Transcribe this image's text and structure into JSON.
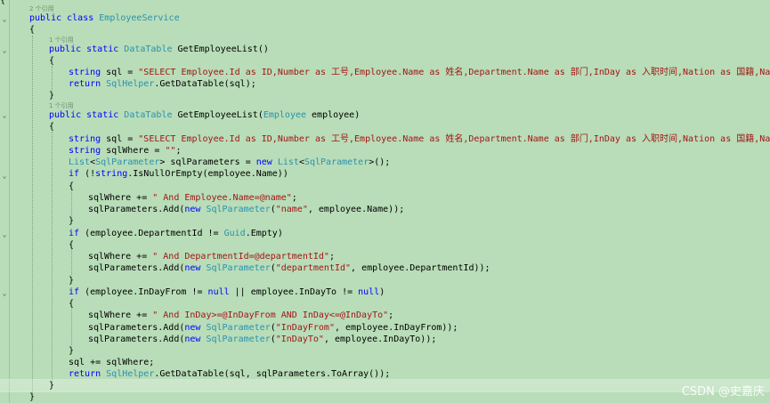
{
  "colors": {
    "background": "#b8ddb8",
    "keyword": "#0000ff",
    "type": "#2b91af",
    "string": "#a31515",
    "codelens": "#6f8f6f"
  },
  "codelens": {
    "class_refs": "2 个引用",
    "method1_refs": "1 个引用",
    "method2_refs": "1 个引用"
  },
  "watermark": "CSDN @史嘉庆",
  "lines": [
    {
      "id": "l0",
      "tokens": [
        {
          "t": "p",
          "v": "{"
        }
      ]
    },
    {
      "id": "l1",
      "tokens": [
        {
          "t": "kw",
          "v": "public class "
        },
        {
          "t": "ty",
          "v": "EmployeeService"
        }
      ]
    },
    {
      "id": "l2",
      "tokens": [
        {
          "t": "p",
          "v": "{"
        }
      ]
    },
    {
      "id": "l3",
      "tokens": [
        {
          "t": "kw",
          "v": "public static "
        },
        {
          "t": "ty",
          "v": "DataTable "
        },
        {
          "t": "p",
          "v": "GetEmployeeList()"
        }
      ]
    },
    {
      "id": "l4",
      "tokens": [
        {
          "t": "p",
          "v": "{"
        }
      ]
    },
    {
      "id": "l5",
      "tokens": [
        {
          "t": "kw",
          "v": "string "
        },
        {
          "t": "p",
          "v": "sql = "
        },
        {
          "t": "str",
          "v": "\"SELECT Employee.Id as ID,Number as 工号,Employee.Name as 姓名,Department.Name as 部门,InDay as 入职时间,Nation as 国籍,NativePlace"
        }
      ]
    },
    {
      "id": "l6",
      "tokens": [
        {
          "t": "kw",
          "v": "return "
        },
        {
          "t": "ty",
          "v": "SqlHelper"
        },
        {
          "t": "p",
          "v": ".GetDataTable(sql);"
        }
      ]
    },
    {
      "id": "l7",
      "tokens": [
        {
          "t": "p",
          "v": "}"
        }
      ]
    },
    {
      "id": "l8",
      "tokens": [
        {
          "t": "kw",
          "v": "public static "
        },
        {
          "t": "ty",
          "v": "DataTable "
        },
        {
          "t": "p",
          "v": "GetEmployeeList("
        },
        {
          "t": "ty",
          "v": "Employee "
        },
        {
          "t": "p",
          "v": "employee)"
        }
      ]
    },
    {
      "id": "l9",
      "tokens": [
        {
          "t": "p",
          "v": "{"
        }
      ]
    },
    {
      "id": "l10",
      "tokens": [
        {
          "t": "kw",
          "v": "string "
        },
        {
          "t": "p",
          "v": "sql = "
        },
        {
          "t": "str",
          "v": "\"SELECT Employee.Id as ID,Number as 工号,Employee.Name as 姓名,Department.Name as 部门,InDay as 入职时间,Nation as 国籍,NativePlace"
        }
      ]
    },
    {
      "id": "l11",
      "tokens": [
        {
          "t": "kw",
          "v": "string "
        },
        {
          "t": "p",
          "v": "sqlWhere = "
        },
        {
          "t": "str",
          "v": "\"\""
        },
        {
          "t": "p",
          "v": ";"
        }
      ]
    },
    {
      "id": "l12",
      "tokens": [
        {
          "t": "ty",
          "v": "List"
        },
        {
          "t": "p",
          "v": "<"
        },
        {
          "t": "ty",
          "v": "SqlParameter"
        },
        {
          "t": "p",
          "v": "> sqlParameters = "
        },
        {
          "t": "kw",
          "v": "new "
        },
        {
          "t": "ty",
          "v": "List"
        },
        {
          "t": "p",
          "v": "<"
        },
        {
          "t": "ty",
          "v": "SqlParameter"
        },
        {
          "t": "p",
          "v": ">();"
        }
      ]
    },
    {
      "id": "l13",
      "tokens": [
        {
          "t": "kw",
          "v": "if "
        },
        {
          "t": "p",
          "v": "(!"
        },
        {
          "t": "kw",
          "v": "string"
        },
        {
          "t": "p",
          "v": ".IsNullOrEmpty(employee.Name))"
        }
      ]
    },
    {
      "id": "l14",
      "tokens": [
        {
          "t": "p",
          "v": "{"
        }
      ]
    },
    {
      "id": "l15",
      "tokens": [
        {
          "t": "p",
          "v": "sqlWhere += "
        },
        {
          "t": "str",
          "v": "\" And Employee.Name=@name\""
        },
        {
          "t": "p",
          "v": ";"
        }
      ]
    },
    {
      "id": "l16",
      "tokens": [
        {
          "t": "p",
          "v": "sqlParameters.Add("
        },
        {
          "t": "kw",
          "v": "new "
        },
        {
          "t": "ty",
          "v": "SqlParameter"
        },
        {
          "t": "p",
          "v": "("
        },
        {
          "t": "str",
          "v": "\"name\""
        },
        {
          "t": "p",
          "v": ", employee.Name));"
        }
      ]
    },
    {
      "id": "l17",
      "tokens": [
        {
          "t": "p",
          "v": "}"
        }
      ]
    },
    {
      "id": "l18",
      "tokens": [
        {
          "t": "kw",
          "v": "if "
        },
        {
          "t": "p",
          "v": "(employee.DepartmentId != "
        },
        {
          "t": "ty",
          "v": "Guid"
        },
        {
          "t": "p",
          "v": ".Empty)"
        }
      ]
    },
    {
      "id": "l19",
      "tokens": [
        {
          "t": "p",
          "v": "{"
        }
      ]
    },
    {
      "id": "l20",
      "tokens": [
        {
          "t": "p",
          "v": "sqlWhere += "
        },
        {
          "t": "str",
          "v": "\" And DepartmentId=@departmentId\""
        },
        {
          "t": "p",
          "v": ";"
        }
      ]
    },
    {
      "id": "l21",
      "tokens": [
        {
          "t": "p",
          "v": "sqlParameters.Add("
        },
        {
          "t": "kw",
          "v": "new "
        },
        {
          "t": "ty",
          "v": "SqlParameter"
        },
        {
          "t": "p",
          "v": "("
        },
        {
          "t": "str",
          "v": "\"departmentId\""
        },
        {
          "t": "p",
          "v": ", employee.DepartmentId));"
        }
      ]
    },
    {
      "id": "l22",
      "tokens": [
        {
          "t": "p",
          "v": "}"
        }
      ]
    },
    {
      "id": "l23",
      "tokens": [
        {
          "t": "kw",
          "v": "if "
        },
        {
          "t": "p",
          "v": "(employee.InDayFrom != "
        },
        {
          "t": "kw",
          "v": "null"
        },
        {
          "t": "p",
          "v": " || employee.InDayTo != "
        },
        {
          "t": "kw",
          "v": "null"
        },
        {
          "t": "p",
          "v": ")"
        }
      ]
    },
    {
      "id": "l24",
      "tokens": [
        {
          "t": "p",
          "v": "{"
        }
      ]
    },
    {
      "id": "l25",
      "tokens": [
        {
          "t": "p",
          "v": "sqlWhere += "
        },
        {
          "t": "str",
          "v": "\" And InDay>=@InDayFrom AND InDay<=@InDayTo\""
        },
        {
          "t": "p",
          "v": ";"
        }
      ]
    },
    {
      "id": "l26",
      "tokens": [
        {
          "t": "p",
          "v": "sqlParameters.Add("
        },
        {
          "t": "kw",
          "v": "new "
        },
        {
          "t": "ty",
          "v": "SqlParameter"
        },
        {
          "t": "p",
          "v": "("
        },
        {
          "t": "str",
          "v": "\"InDayFrom\""
        },
        {
          "t": "p",
          "v": ", employee.InDayFrom));"
        }
      ]
    },
    {
      "id": "l27",
      "tokens": [
        {
          "t": "p",
          "v": "sqlParameters.Add("
        },
        {
          "t": "kw",
          "v": "new "
        },
        {
          "t": "ty",
          "v": "SqlParameter"
        },
        {
          "t": "p",
          "v": "("
        },
        {
          "t": "str",
          "v": "\"InDayTo\""
        },
        {
          "t": "p",
          "v": ", employee.InDayTo));"
        }
      ]
    },
    {
      "id": "l28",
      "tokens": [
        {
          "t": "p",
          "v": "}"
        }
      ]
    },
    {
      "id": "l29",
      "tokens": [
        {
          "t": "p",
          "v": "sql += sqlWhere;"
        }
      ]
    },
    {
      "id": "l30",
      "tokens": [
        {
          "t": "kw",
          "v": "return "
        },
        {
          "t": "ty",
          "v": "SqlHelper"
        },
        {
          "t": "p",
          "v": ".GetDataTable(sql, sqlParameters.ToArray());"
        }
      ]
    },
    {
      "id": "l31",
      "tokens": [
        {
          "t": "p",
          "v": "}"
        }
      ]
    },
    {
      "id": "l32",
      "tokens": [
        {
          "t": "p",
          "v": "}"
        }
      ]
    }
  ]
}
